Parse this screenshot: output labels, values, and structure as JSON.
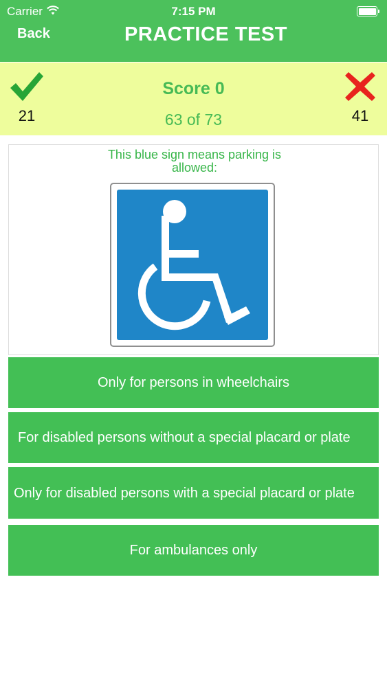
{
  "status_bar": {
    "carrier": "Carrier",
    "time": "7:15 PM",
    "icons": [
      "wifi-icon",
      "battery-icon"
    ]
  },
  "nav": {
    "back_label": "Back",
    "title": "PRACTICE TEST"
  },
  "score": {
    "correct_count": "21",
    "wrong_count": "41",
    "title": "Score 0",
    "progress": "63 of 73",
    "icons": {
      "correct": "checkmark-icon",
      "wrong": "cross-icon"
    }
  },
  "question": {
    "text": "This blue sign means parking is allowed:",
    "image": "wheelchair-sign-icon"
  },
  "answers": [
    {
      "label": "Only for persons in wheelchairs"
    },
    {
      "label": "For disabled persons without a special placard or plate"
    },
    {
      "label": "Only for disabled persons with a special placard or plate"
    },
    {
      "label": "For ambulances only"
    }
  ],
  "colors": {
    "header_green": "#4cc15c",
    "score_bg": "#eefd9c",
    "score_text": "#47ba55",
    "answer_green": "#43bf55",
    "sign_blue": "#1f86c8",
    "wrong_red": "#e8231e",
    "correct_green": "#27a536"
  }
}
